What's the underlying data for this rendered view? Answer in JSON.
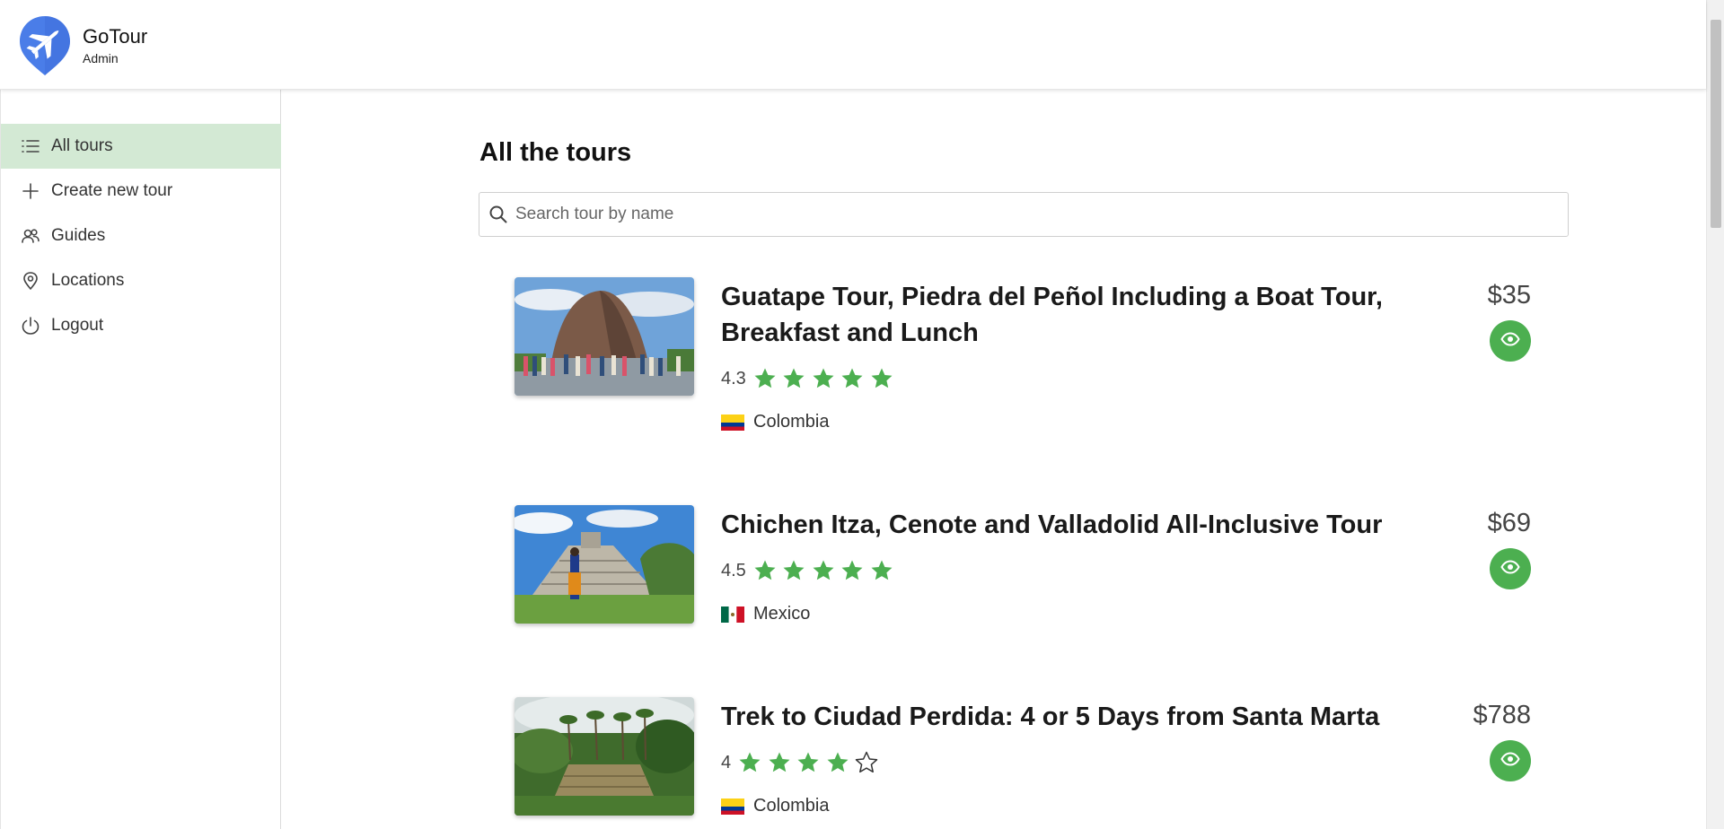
{
  "app": {
    "name": "GoTour",
    "role": "Admin",
    "brand_color": "#4a7de8"
  },
  "sidebar": {
    "items": [
      {
        "label": "All tours",
        "icon": "list-icon",
        "active": true
      },
      {
        "label": "Create new tour",
        "icon": "plus-icon",
        "active": false
      },
      {
        "label": "Guides",
        "icon": "users-icon",
        "active": false
      },
      {
        "label": "Locations",
        "icon": "map-pin-icon",
        "active": false
      },
      {
        "label": "Logout",
        "icon": "power-icon",
        "active": false
      }
    ]
  },
  "main": {
    "title": "All the tours",
    "search": {
      "placeholder": "Search tour by name",
      "value": ""
    }
  },
  "tours": [
    {
      "title": "Guatape Tour, Piedra del Peñol Including a Boat Tour, Breakfast and Lunch",
      "rating": "4.3",
      "stars_filled": 5,
      "country": "Colombia",
      "flag_icon": "colombia-flag-icon",
      "price": "$35"
    },
    {
      "title": "Chichen Itza, Cenote and Valladolid All-Inclusive Tour",
      "rating": "4.5",
      "stars_filled": 5,
      "country": "Mexico",
      "flag_icon": "mexico-flag-icon",
      "price": "$69"
    },
    {
      "title": "Trek to Ciudad Perdida: 4 or 5 Days from Santa Marta",
      "rating": "4",
      "stars_filled": 4,
      "country": "Colombia",
      "flag_icon": "colombia-flag-icon",
      "price": "$788"
    }
  ],
  "colors": {
    "accent": "#4caf50",
    "active_nav": "#d3e9d4"
  }
}
